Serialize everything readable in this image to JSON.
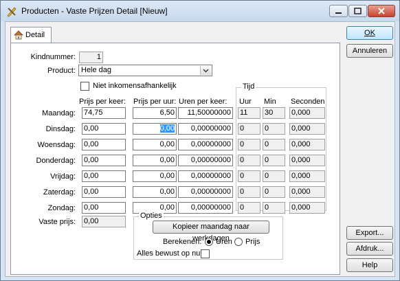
{
  "window": {
    "title": "Producten - Vaste Prijzen Detail [Nieuw]"
  },
  "tab": {
    "label": "Detail"
  },
  "kindnummer": {
    "label": "Kindnummer:",
    "value": "1"
  },
  "product": {
    "label": "Product:",
    "value": "Hele dag"
  },
  "niet_inkomens": {
    "label": "Niet inkomensafhankelijk",
    "checked": false
  },
  "columns": {
    "prijs_keer": "Prijs per keer:",
    "prijs_uur": "Prijs per uur:",
    "uren_keer": "Uren per keer:"
  },
  "tijd": {
    "title": "Tijd",
    "uur": "Uur",
    "min": "Min",
    "seconden": "Seconden"
  },
  "rows": [
    {
      "day": "Maandag:",
      "prijs_keer": "74,75",
      "prijs_uur": "6,50",
      "uren": "11,50000000",
      "uur": "11",
      "min": "30",
      "sec": "0,000"
    },
    {
      "day": "Dinsdag:",
      "prijs_keer": "0,00",
      "prijs_uur": "0,00",
      "uren": "0,00000000",
      "uur": "0",
      "min": "0",
      "sec": "0,000"
    },
    {
      "day": "Woensdag:",
      "prijs_keer": "0,00",
      "prijs_uur": "0,00",
      "uren": "0,00000000",
      "uur": "0",
      "min": "0",
      "sec": "0,000"
    },
    {
      "day": "Donderdag:",
      "prijs_keer": "0,00",
      "prijs_uur": "0,00",
      "uren": "0,00000000",
      "uur": "0",
      "min": "0",
      "sec": "0,000"
    },
    {
      "day": "Vrijdag:",
      "prijs_keer": "0,00",
      "prijs_uur": "0,00",
      "uren": "0,00000000",
      "uur": "0",
      "min": "0",
      "sec": "0,000"
    },
    {
      "day": "Zaterdag:",
      "prijs_keer": "0,00",
      "prijs_uur": "0,00",
      "uren": "0,00000000",
      "uur": "0",
      "min": "0",
      "sec": "0,000"
    },
    {
      "day": "Zondag:",
      "prijs_keer": "0,00",
      "prijs_uur": "0,00",
      "uren": "0,00000000",
      "uur": "0",
      "min": "0",
      "sec": "0,000"
    }
  ],
  "vaste_prijs": {
    "label": "Vaste prijs:",
    "value": "0,00"
  },
  "opties": {
    "title": "Opties",
    "copy_button": "Kopieer maandag naar werkdagen",
    "berekenen_label": "Berekenen:",
    "radio_uren": "Uren",
    "radio_prijs": "Prijs",
    "selected": "Uren",
    "alles_bewust": "Alles bewust op nul:"
  },
  "buttons": {
    "ok": "OK",
    "annuleren": "Annuleren",
    "export": "Export...",
    "afdruk": "Afdruk...",
    "help": "Help"
  },
  "icons": {
    "app": "pencil-ruler-icon",
    "tab": "house-icon"
  }
}
